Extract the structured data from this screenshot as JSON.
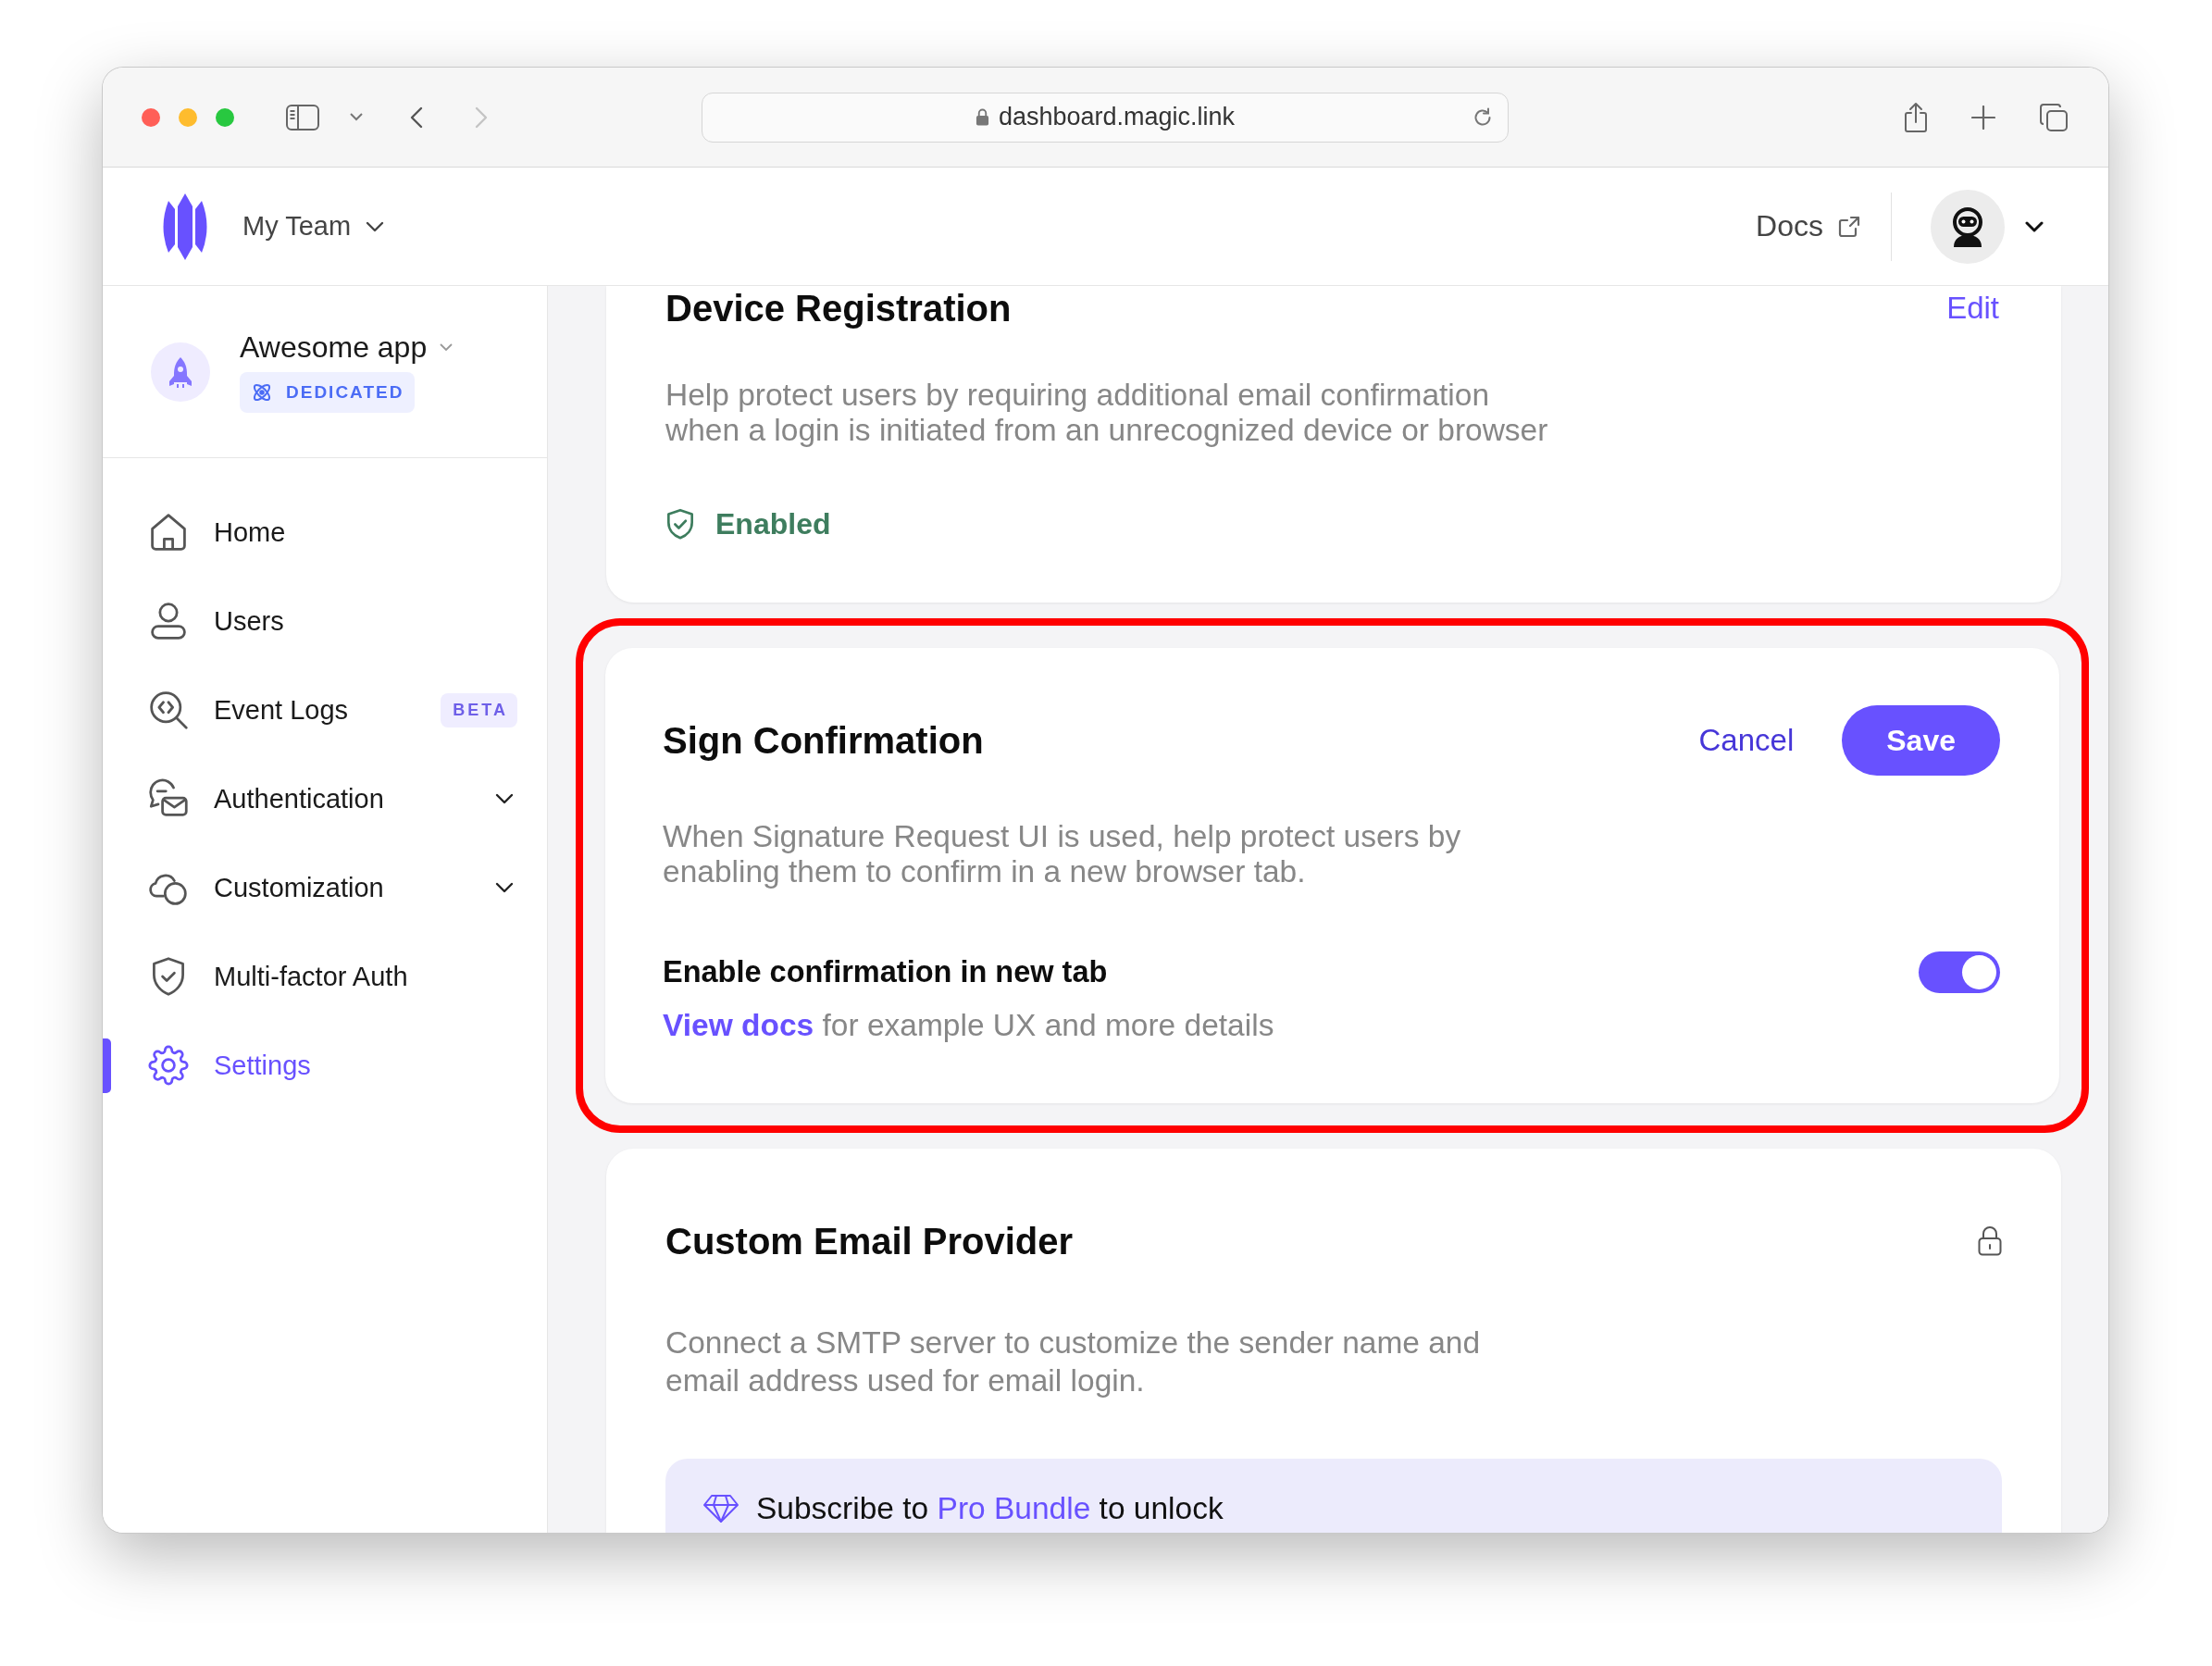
{
  "browser": {
    "url": "dashboard.magic.link",
    "back_enabled": true,
    "forward_enabled": false
  },
  "header": {
    "team": "My Team",
    "docs": "Docs"
  },
  "sidebar": {
    "app": {
      "name": "Awesome app",
      "plan": "DEDICATED"
    },
    "items": [
      {
        "label": "Home",
        "selected": false,
        "expandable": false
      },
      {
        "label": "Users",
        "selected": false,
        "expandable": false
      },
      {
        "label": "Event Logs",
        "badge": "BETA",
        "selected": false,
        "expandable": false
      },
      {
        "label": "Authentication",
        "selected": false,
        "expandable": true
      },
      {
        "label": "Customization",
        "selected": false,
        "expandable": true
      },
      {
        "label": "Multi-factor Auth",
        "selected": false,
        "expandable": false
      },
      {
        "label": "Settings",
        "selected": true,
        "expandable": false
      }
    ]
  },
  "cards": [
    {
      "kind": "status",
      "title": "Device Registration",
      "action": "Edit",
      "description": [
        "Help protect users by requiring additional email confirmation",
        "when a login is initiated from an unrecognized device or browser"
      ],
      "status": {
        "label": "Enabled",
        "on": true
      },
      "highlighted": false
    },
    {
      "kind": "toggle",
      "title": "Sign Confirmation",
      "buttons": [
        {
          "label": "Cancel",
          "kind": "text"
        },
        {
          "label": "Save",
          "kind": "primary"
        }
      ],
      "description": [
        "When Signature Request UI is used, help protect users by",
        "enabling them to confirm in a new browser tab."
      ],
      "setting": {
        "label": "Enable confirmation in new tab",
        "on": true,
        "link": "View docs",
        "hint": "for example UX and more details"
      },
      "highlighted": true
    },
    {
      "kind": "locked",
      "title": "Custom Email Provider",
      "locked": true,
      "description": [
        "Connect a SMTP server to customize the sender name and",
        "email address used for email login."
      ],
      "upsell": {
        "before": "Subscribe to",
        "link": "Pro Bundle",
        "after": "to unlock"
      },
      "highlighted": false
    }
  ]
}
